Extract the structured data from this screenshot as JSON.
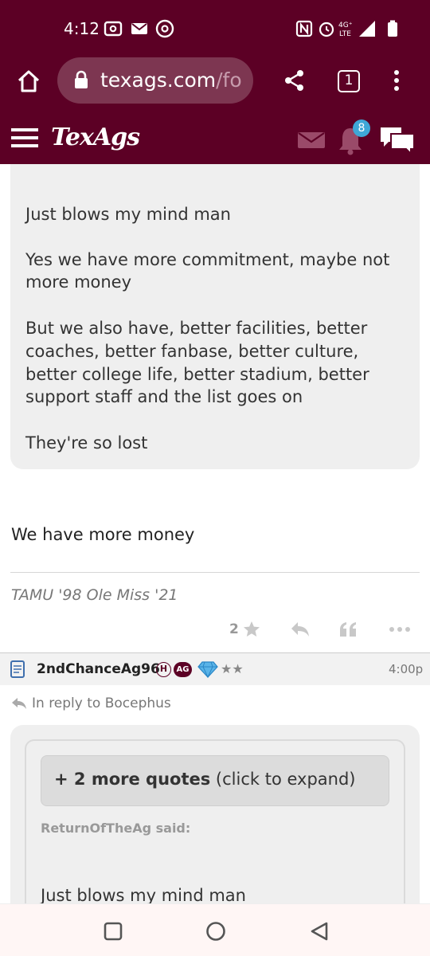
{
  "status_bar": {
    "time": "4:12",
    "network_label": "4G+ LTE"
  },
  "browser": {
    "url_host": "texags.com",
    "url_rest": "/fo",
    "tab_count": "1"
  },
  "site_header": {
    "logo": "TexAgs",
    "notification_count": "8"
  },
  "quote_1": {
    "lines": [
      "Just blows my mind man",
      "Yes we have more commitment, maybe not",
      "more money",
      "But we also have, better facilities, better",
      "coaches, better fanbase, better culture,",
      "better college life, better stadium, better",
      "support staff and the list goes on",
      "They're so lost"
    ]
  },
  "post_1": {
    "reply": "We have more money",
    "signature": "TAMU '98 Ole Miss '21",
    "star_count": "2"
  },
  "post_2": {
    "author": "2ndChanceAg96",
    "badge_h": "H",
    "badge_ag": "AG",
    "rank_stars": "★★",
    "time": "4:00p",
    "in_reply_to": "In reply to Bocephus",
    "expand_bold": "+ 2 more quotes",
    "expand_rest": " (click to expand)",
    "quoted_author_said": "ReturnOfTheAg said:",
    "quote_first_line": "Just blows my mind man"
  },
  "colors": {
    "maroon": "#5c0025",
    "badge_blue": "#3fa7d7",
    "quote_bg": "#efefef"
  }
}
